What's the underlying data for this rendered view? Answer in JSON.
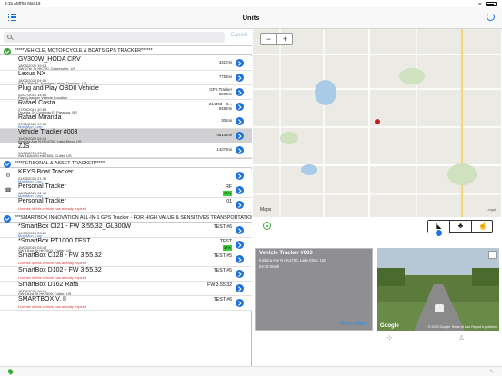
{
  "status_bar": {
    "time": "9:15 AM",
    "date": "Thu Mar 19"
  },
  "nav": {
    "title": "Units"
  },
  "search": {
    "placeholder": "",
    "cancel_label": "Cancel"
  },
  "groups": [
    {
      "title": "*****VEHICLE, MOTORCYCLE & BOATS GPS TRACKER******",
      "color": "#3aa63a",
      "units": [
        {
          "name": "GV300W_HODA CRV",
          "line1": "18/03/2020 19:13",
          "line2": "SW 27th St HK700, Gainesville, US",
          "line3": "",
          "right1": "3317mi",
          "right2": "",
          "selected": false
        },
        {
          "name": "Lexus NX",
          "line1": "18/03/2020 04:05",
          "line2": "SW 136th St, Kendale Lakes-Tamiami, US",
          "line3": "",
          "right1": "7753mi",
          "right2": "",
          "selected": false
        },
        {
          "name": "Plug and Play OBDII Vehicle",
          "line1": "02/07/2019 14:58",
          "line2": "Rapid-tracker Vehicle Location",
          "line3": "",
          "right1": "GPS Tracker",
          "right2": "5693mi",
          "selected": false
        },
        {
          "name": "Rafael Costa",
          "line1": "27/09/2019 10:53",
          "line2": "Quadra 34 Conjunto E, Paranoá, BR",
          "line3": "",
          "right1": "214493 - G...",
          "right2": "9482mi",
          "selected": false
        },
        {
          "name": "Rafael Miranda",
          "line1": "07/02/2020 17:58",
          "line2": "MotoMon Corp",
          "line3": "",
          "right1": "305mi",
          "right2": "",
          "selected": false
        },
        {
          "name": "Vehicle Tracker #003",
          "line1": "19/03/2020 04:15",
          "line2": "Kinloira Ave N HK4700, Lake Elmo, US",
          "line3": "",
          "right1": "48134mi",
          "right2": "",
          "selected": true
        },
        {
          "name": "ZJS",
          "line1": "19/03/2020 03:50",
          "line2": "SW 163rd St HK7600, Cutler, US",
          "line3": "",
          "right1": "14273mi",
          "right2": "",
          "selected": false
        }
      ]
    },
    {
      "title": "****PERSONAL & ASSET TRACKER*****",
      "color": "#1f72dc",
      "units": [
        {
          "name": "KEYS Boat Tracker",
          "line1": "01/03/2020 21:39",
          "line2": "MotoMon Corp",
          "line3": "",
          "right1": "",
          "right2": "",
          "selected": false
        },
        {
          "name": "Personal Tracker",
          "line1": "18/03/2020 01:48",
          "line2": "MotoMon Corp",
          "line3": "",
          "right1": "RF",
          "right2": "92%",
          "selected": false
        },
        {
          "name": "Personal Tracker",
          "line1": "",
          "line2": "License of this vehicle has already expired",
          "line3": "",
          "right1": "01",
          "right2": "",
          "selected": false
        }
      ]
    },
    {
      "title": "***SMARTBOX INNOVATION ALL-IN-1 GPS Tracker - FOR HIGH VALUE & SENSITIVES TRANSPORTATION***",
      "color": "#1f72dc",
      "units": [
        {
          "name": "*SmartBox CI21 - FW 3.55.32_GL300W",
          "line1": "19/03/2020 03:21",
          "line2": "MotoMon Corp",
          "line3": "",
          "right1": "TEST #6",
          "right2": "",
          "selected": false
        },
        {
          "name": "*SmartBox PT1000 TEST",
          "line1": "19/03/2020 03:48",
          "line2": "SW 181st St HK7600, Cutler, US",
          "line3": "",
          "right1": "TEST",
          "right2": "37%",
          "selected": false
        },
        {
          "name": "SmartBox C128 - FW 3.55.32",
          "line1": "",
          "line2": "License of this vehicle has already expired",
          "line3": "",
          "right1": "TEST #5",
          "right2": "",
          "selected": false
        },
        {
          "name": "SmartBox D102 - FW 3.55.32",
          "line1": "",
          "line2": "License of this vehicle has already expired",
          "line3": "",
          "right1": "TEST #5",
          "right2": "",
          "selected": false
        },
        {
          "name": "SmartBox D162 Rafa",
          "line1": "16/03/2020 09:19",
          "line2": "SW 181st St HK7600, Cutler, US",
          "line3": "",
          "right1": "FW 3.55.32",
          "right2": "",
          "selected": false
        },
        {
          "name": "SMARTBOX V. II",
          "line1": "",
          "line2": "License of this vehicle has already expired",
          "line3": "",
          "right1": "TEST #6",
          "right2": "",
          "selected": false
        }
      ]
    }
  ],
  "map": {
    "zoom_out": "−",
    "zoom_in": "+",
    "attribution": "Maps",
    "legal": "Legal"
  },
  "card": {
    "title": "Vehicle Tracker #003",
    "address": "Kinloira Ave N HK4700, Lake Elmo, US",
    "meta": "04:15   0mph",
    "watermark": "MotoMon"
  },
  "street": {
    "brand": "Google",
    "legal": "© 2020 Google  Terms of Use  Report a problem"
  },
  "colors": {
    "accent": "#1f72dc",
    "selected_row": "#d1d1d3",
    "warning": "#d63a3a"
  }
}
